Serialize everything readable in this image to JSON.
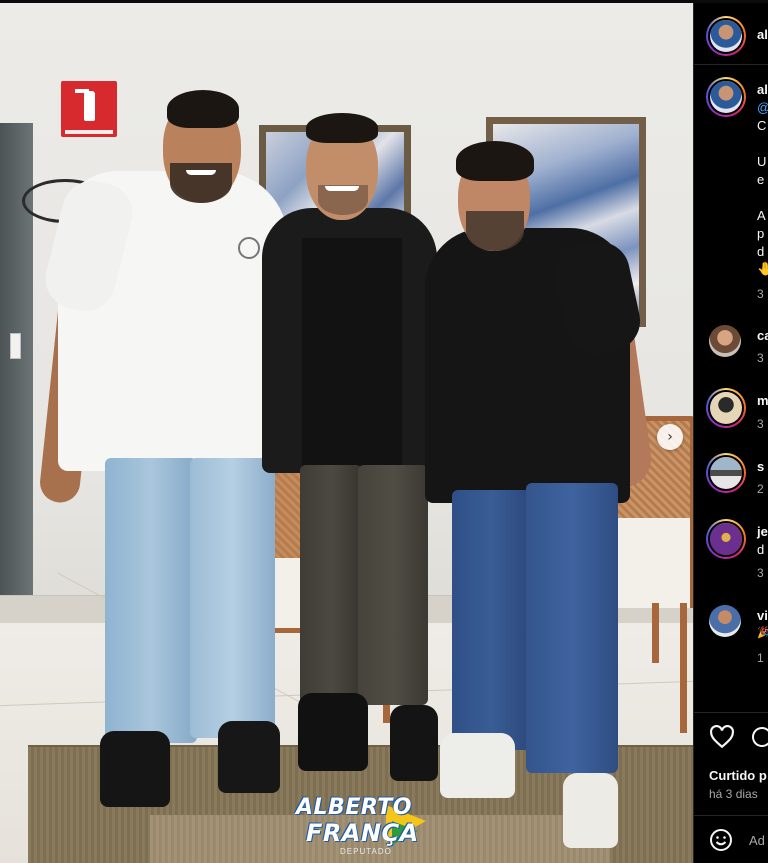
{
  "photo": {
    "logo_line1": "ALBERTO",
    "logo_line2": "FRANÇA",
    "logo_sub": "DEPUTADO",
    "next_button": "›"
  },
  "panel": {
    "header_username": "al",
    "caption_username": "al",
    "caption_lines": [
      "@",
      "C",
      "",
      "U",
      "e",
      "",
      "A",
      "p",
      "d",
      "🤚"
    ],
    "caption_time": "3",
    "comments": [
      {
        "user": "ca",
        "time": "3"
      },
      {
        "user": "m",
        "time": "3"
      },
      {
        "user": "s",
        "time": "2"
      },
      {
        "user": "je",
        "line2": "d",
        "time": "3"
      },
      {
        "user": "vi",
        "line2": "🎉",
        "time": "1"
      }
    ],
    "liked_by": "Curtido p",
    "posted_ago": "há 3 dias",
    "add_comment_placeholder": "Ad"
  },
  "icons": {
    "like": "heart-icon",
    "comment": "comment-icon",
    "emoji": "emoji-icon",
    "next": "chevron-right-icon"
  }
}
